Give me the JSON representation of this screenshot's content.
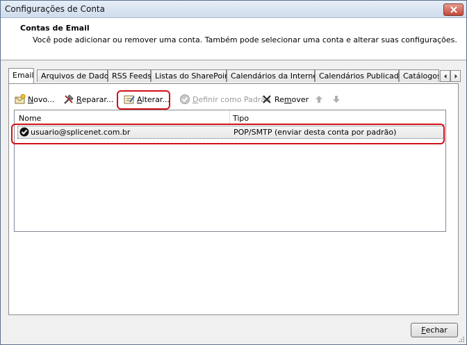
{
  "window": {
    "title": "Configurações de Conta"
  },
  "header": {
    "title": "Contas de Email",
    "description": "Você pode adicionar ou remover uma conta. Também pode selecionar uma conta e alterar suas configurações."
  },
  "tabs": [
    {
      "label": "Email",
      "active": true
    },
    {
      "label": "Arquivos de Dados"
    },
    {
      "label": "RSS Feeds"
    },
    {
      "label": "Listas do SharePoint"
    },
    {
      "label": "Calendários da Internet"
    },
    {
      "label": "Calendários Publicados"
    },
    {
      "label": "Catálogos"
    }
  ],
  "toolbar": {
    "novo": {
      "accel": "N",
      "rest": "ovo..."
    },
    "reparar": {
      "accel": "R",
      "rest": "eparar..."
    },
    "alterar": {
      "accel": "A",
      "rest": "lterar..."
    },
    "definir": {
      "accel": "D",
      "rest": "efinir como Padrão"
    },
    "remover": {
      "pre": "Re",
      "accel": "m",
      "rest": "over"
    }
  },
  "list": {
    "columns": [
      "Nome",
      "Tipo"
    ],
    "rows": [
      {
        "name": "usuario@splicenet.com.br",
        "type": "POP/SMTP (enviar desta conta por padrão)"
      }
    ]
  },
  "footer": {
    "close": {
      "accel": "F",
      "rest": "echar"
    }
  },
  "colors": {
    "highlight": "#d0101a"
  }
}
